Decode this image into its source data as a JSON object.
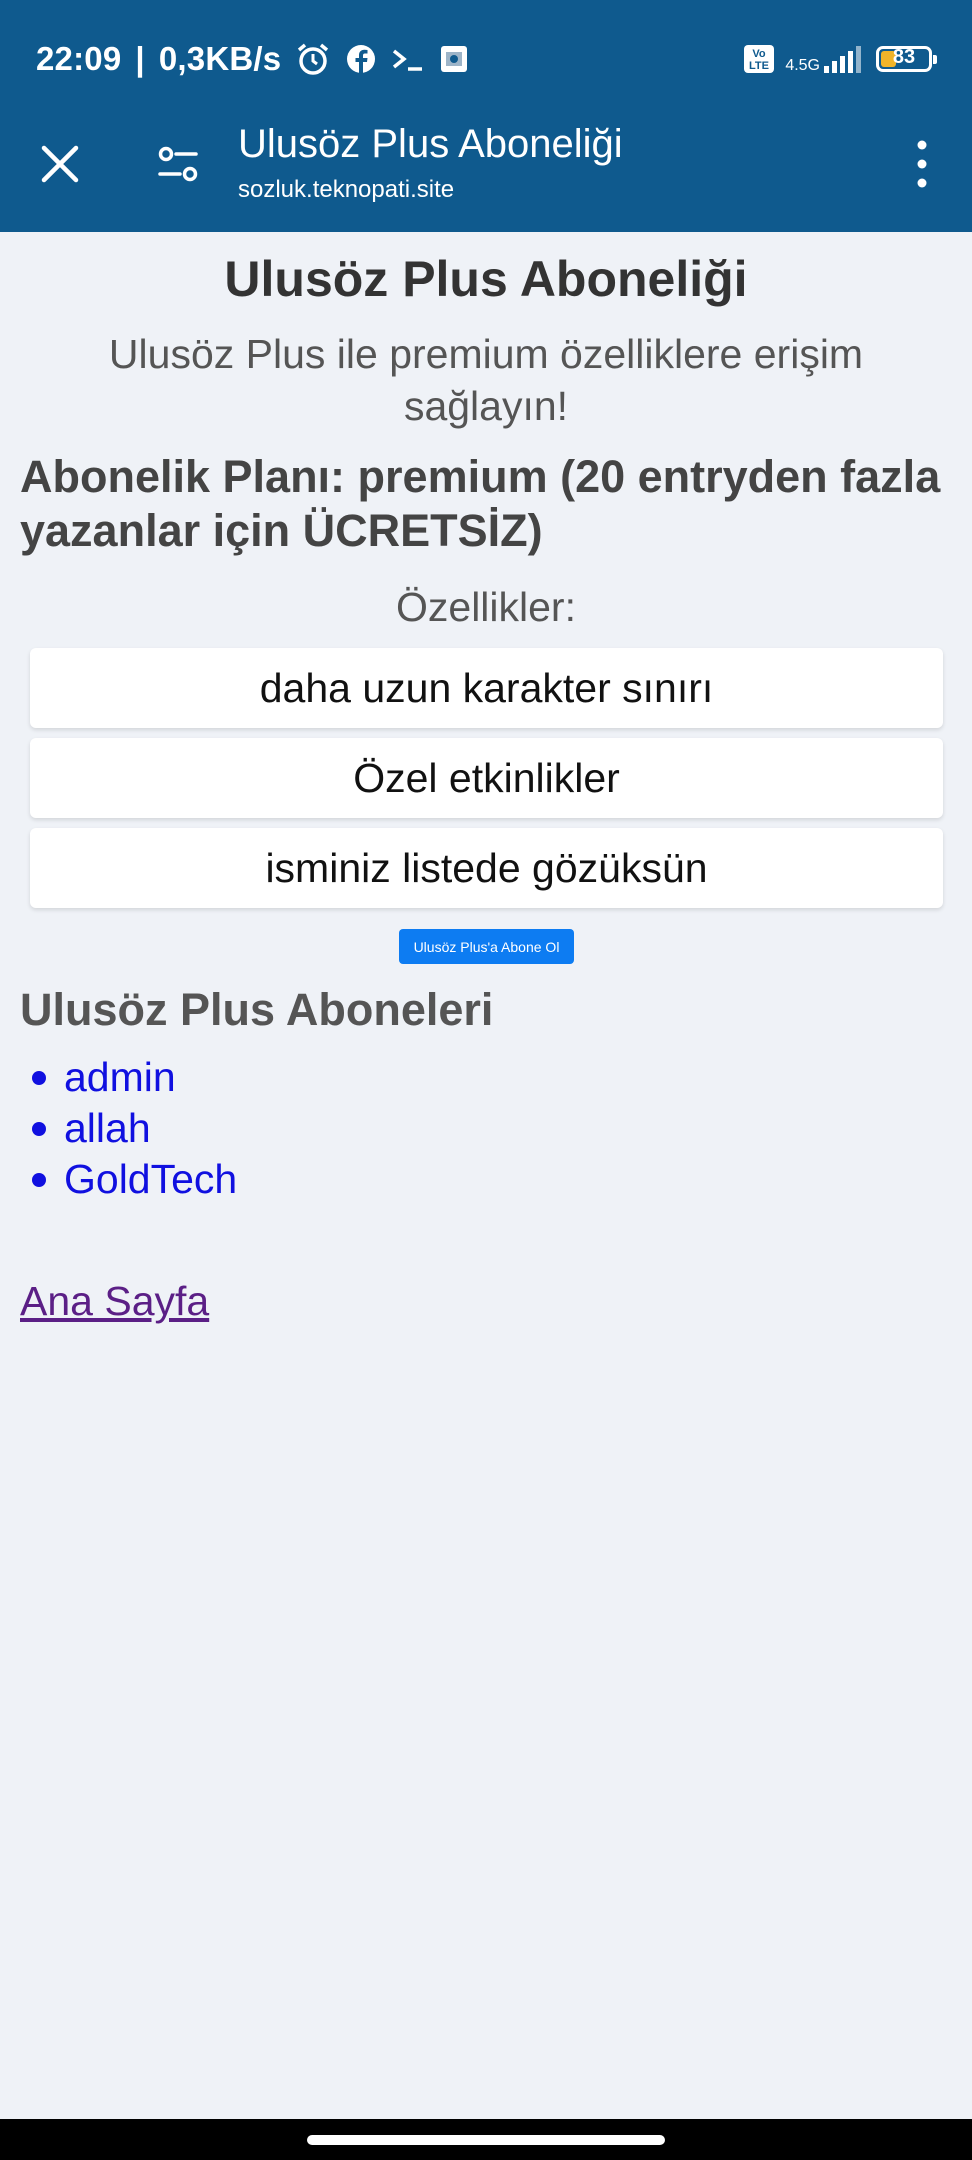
{
  "status_bar": {
    "time": "22:09",
    "speed": "0,3KB/s",
    "separator": "|",
    "network": "4.5G",
    "volte": "Vo LTE",
    "battery": "83",
    "icons": [
      "alarm-icon",
      "facebook-icon",
      "terminal-icon",
      "app-icon",
      "volte-icon",
      "signal-icon",
      "battery-icon"
    ]
  },
  "toolbar": {
    "title": "Ulusöz Plus Aboneliği",
    "url": "sozluk.teknopati.site",
    "icons": [
      "close-icon",
      "tune-icon",
      "more-vert-icon"
    ]
  },
  "page": {
    "heading": "Ulusöz Plus Aboneliği",
    "lead": "Ulusöz Plus ile premium özelliklere erişim sağlayın!",
    "plan": "Abonelik Planı: premium (20 entryden fazla yazanlar için ÜCRETSİZ)",
    "features_title": "Özellikler:",
    "features": [
      "daha uzun karakter sınırı",
      "Özel etkinlikler",
      "isminiz listede gözüksün"
    ],
    "subscribe_button": "Ulusöz Plus'a Abone Ol",
    "subscribers_title": "Ulusöz Plus Aboneleri",
    "subscribers": [
      "admin",
      "allah",
      "GoldTech"
    ],
    "home_link": "Ana Sayfa"
  },
  "colors": {
    "toolbar_bg": "#0f5a8e",
    "page_bg": "#eff2f7",
    "button_bg": "#0d7cf2",
    "link": "#1010e0",
    "visited_link": "#5b1f86"
  }
}
